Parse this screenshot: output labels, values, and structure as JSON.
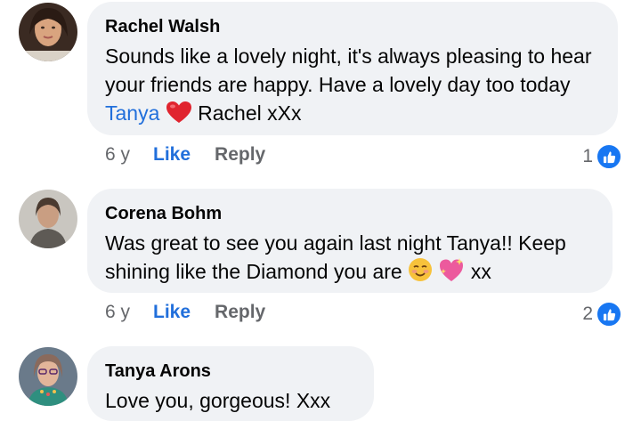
{
  "comments": [
    {
      "author": "Rachel Walsh",
      "text_before": "Sounds like a lovely night, it's always pleasing to hear your friends are happy. Have a lovely day too today ",
      "mention": "Tanya",
      "emoji_icons": [
        "red-heart-icon"
      ],
      "text_after": " Rachel xXx",
      "age": "6 y",
      "like_label": "Like",
      "reply_label": "Reply",
      "reaction_count": "1"
    },
    {
      "author": "Corena Bohm",
      "text_before": "Was great to see you again last night Tanya!! Keep shining like the Diamond you are ",
      "emoji_icons": [
        "smiling-face-icon",
        "sparkling-heart-icon"
      ],
      "text_after": " xx",
      "age": "6 y",
      "like_label": "Like",
      "reply_label": "Reply",
      "reaction_count": "2"
    },
    {
      "author": "Tanya Arons",
      "text_before": "Love you, gorgeous! Xxx"
    }
  ],
  "colors": {
    "bubble": "#f0f2f5",
    "link_blue": "#216fdb",
    "meta_gray": "#65676b",
    "like_badge": "#1877f2"
  }
}
